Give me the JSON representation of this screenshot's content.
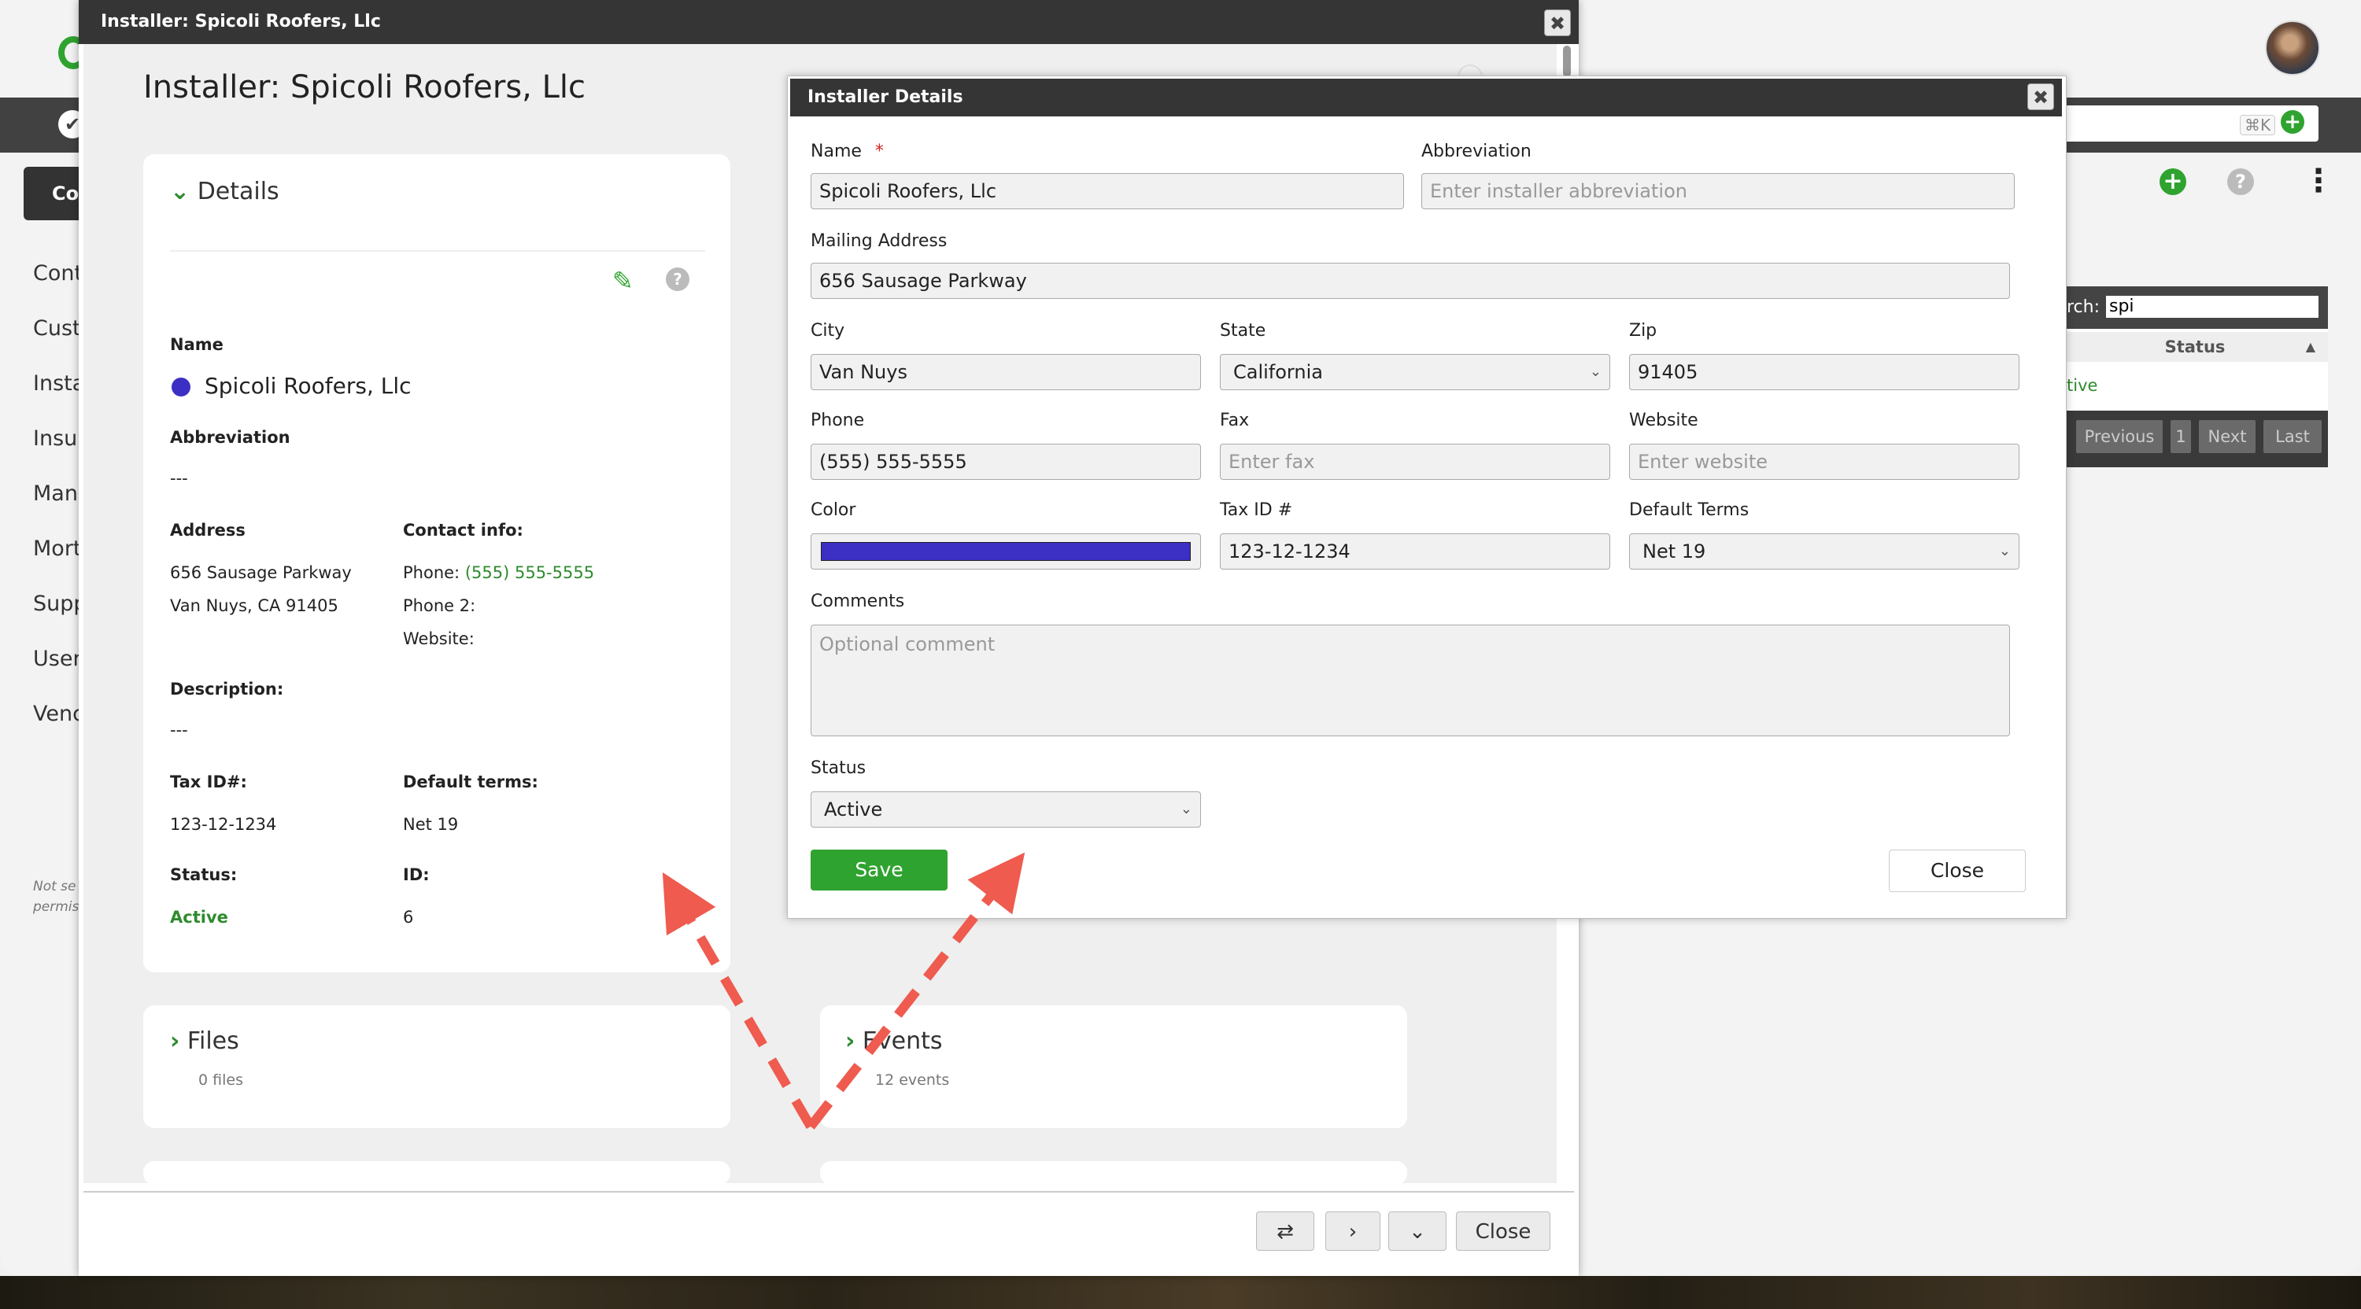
{
  "background": {
    "nav_button": "Co",
    "nav_items": [
      "Cont",
      "Cust",
      "Insta",
      "Insur",
      "Manu",
      "Mort",
      "Supp",
      "User",
      "Venc"
    ],
    "note_lines": [
      "Not se",
      "permis"
    ],
    "shortcut": "⌘K",
    "search_label": "rch:",
    "search_value": "spi",
    "status_header": "Status",
    "status_value": "tive",
    "pager": {
      "previous": "Previous",
      "page": "1",
      "next": "Next",
      "last": "Last"
    }
  },
  "main_dialog": {
    "window_title": "Installer: Spicoli Roofers, Llc",
    "heading": "Installer: Spicoli Roofers, Llc",
    "details": {
      "title": "Details",
      "name_label": "Name",
      "name_value": "Spicoli Roofers, Llc",
      "color": "#3c2fc4",
      "abbreviation_label": "Abbreviation",
      "abbreviation_value": "---",
      "address_label": "Address",
      "address_line1": "656 Sausage Parkway",
      "address_line2": "Van Nuys, CA 91405",
      "contact_label": "Contact info:",
      "phone_label": "Phone:",
      "phone_value": "(555) 555-5555",
      "phone2_label": "Phone 2:",
      "website_label": "Website:",
      "description_label": "Description:",
      "description_value": "---",
      "taxid_label": "Tax ID#:",
      "taxid_value": "123-12-1234",
      "terms_label": "Default terms:",
      "terms_value": "Net 19",
      "status_label": "Status:",
      "status_value": "Active",
      "id_label": "ID:",
      "id_value": "6"
    },
    "files": {
      "title": "Files",
      "count": "0 files"
    },
    "events": {
      "title": "Events",
      "count": "12 events"
    },
    "footer": {
      "close_label": "Close"
    }
  },
  "installer_details": {
    "title": "Installer Details",
    "name_label": "Name",
    "required_mark": "*",
    "name_value": "Spicoli Roofers, Llc",
    "abbreviation_label": "Abbreviation",
    "abbreviation_placeholder": "Enter installer abbreviation",
    "mailing_label": "Mailing Address",
    "mailing_value": "656 Sausage Parkway",
    "city_label": "City",
    "city_value": "Van Nuys",
    "state_label": "State",
    "state_value": "California",
    "zip_label": "Zip",
    "zip_value": "91405",
    "phone_label": "Phone",
    "phone_value": "(555) 555-5555",
    "fax_label": "Fax",
    "fax_placeholder": "Enter fax",
    "website_label": "Website",
    "website_placeholder": "Enter website",
    "color_label": "Color",
    "color_value": "#3c2fc4",
    "taxid_label": "Tax ID #",
    "taxid_value": "123-12-1234",
    "terms_label": "Default Terms",
    "terms_value": "Net 19",
    "comments_label": "Comments",
    "comments_placeholder": "Optional comment",
    "status_label": "Status",
    "status_value": "Active",
    "save_label": "Save",
    "close_label": "Close"
  },
  "colors": {
    "accent_green": "#2fa32f",
    "titlebar": "#353535",
    "arrow": "#ef5b4f"
  }
}
